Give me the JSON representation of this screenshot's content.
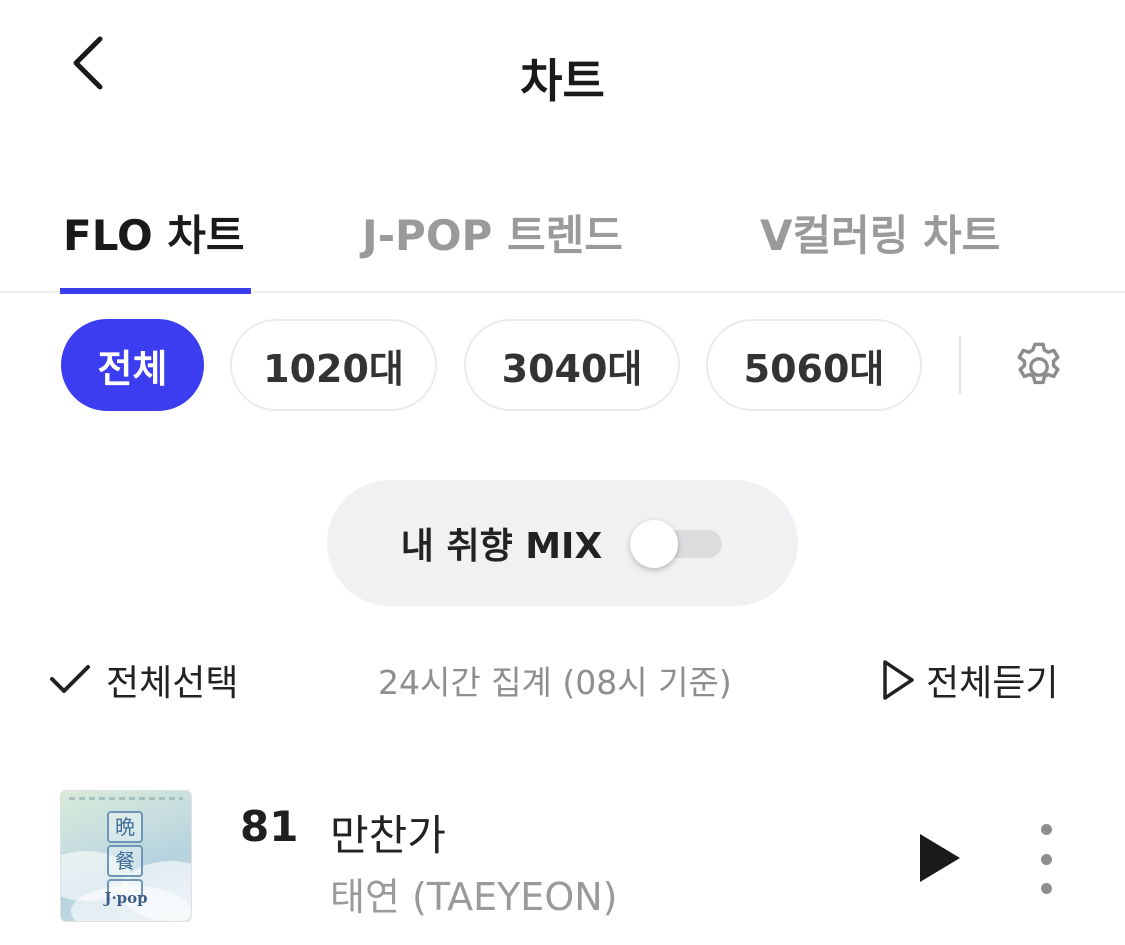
{
  "header": {
    "title": "차트",
    "back_icon": "chevron-left-icon"
  },
  "tabs": [
    {
      "label": "FLO 차트",
      "active": true
    },
    {
      "label": "J-POP 트렌드",
      "active": false
    },
    {
      "label": "V컬러링 차트",
      "active": false
    }
  ],
  "filters": {
    "chips": [
      {
        "label": "전체",
        "active": true
      },
      {
        "label": "1020대",
        "active": false
      },
      {
        "label": "3040대",
        "active": false
      },
      {
        "label": "5060대",
        "active": false
      }
    ],
    "settings_icon": "gear-icon"
  },
  "mix": {
    "label": "내 취향 MIX",
    "enabled": false
  },
  "actions": {
    "select_all": "전체선택",
    "aggregation": "24시간 집계 (08시 기준)",
    "play_all": "전체듣기"
  },
  "songs": [
    {
      "rank": "81",
      "title": "만찬가",
      "artist": "태연 (TAEYEON)"
    }
  ],
  "colors": {
    "accent": "#3c3cf0",
    "inactive_text": "#9a9a9a",
    "pill_bg": "#f1f1f3"
  }
}
